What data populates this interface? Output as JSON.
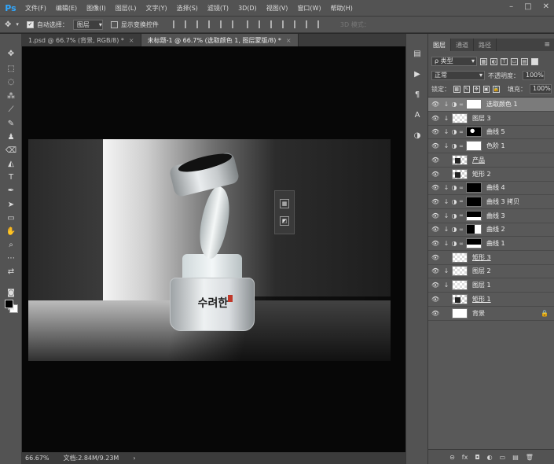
{
  "app": {
    "logo": "Ps"
  },
  "menubar": {
    "items": [
      "文件(F)",
      "编辑(E)",
      "图像(I)",
      "图层(L)",
      "文字(Y)",
      "选择(S)",
      "滤镜(T)",
      "3D(D)",
      "视图(V)",
      "窗口(W)",
      "帮助(H)"
    ],
    "window_controls": [
      "–",
      "□",
      "✕"
    ]
  },
  "optionsbar": {
    "auto_select_label": "自动选择：",
    "auto_select_value": "图层",
    "transform_label": "显示变换控件",
    "mode3d_label": "3D 模式："
  },
  "tabs": [
    {
      "label": "1.psd @ 66.7% (背景, RGB/8) *",
      "close": "×"
    },
    {
      "label": "未标题-1 @ 66.7% (选取颜色 1, 图层蒙版/8) *",
      "close": "×"
    }
  ],
  "statusbar": {
    "zoom": "66.67%",
    "doc_info": "文档:2.84M/9.23M",
    "arrow": "›"
  },
  "canvas": {
    "jar_brand": "수려한"
  },
  "panel": {
    "tabs": [
      "图层",
      "通道",
      "路径"
    ],
    "menu_icon": "≡",
    "filter_label": "ρ 类型",
    "blend_mode": "正常",
    "opacity_label": "不透明度：",
    "opacity_value": "100%",
    "lock_label": "锁定：",
    "fill_label": "填充：",
    "fill_value": "100%",
    "layers": [
      {
        "name": "选取颜色 1",
        "thumb": "white",
        "adj": true,
        "clip": true,
        "selected": true
      },
      {
        "name": "图层 3",
        "thumb": "check",
        "adj": false,
        "clip": true
      },
      {
        "name": "曲线 5",
        "thumb": "spot",
        "adj": true,
        "clip": true
      },
      {
        "name": "色阶 1",
        "thumb": "white",
        "adj": true,
        "clip": true
      },
      {
        "name": "产品",
        "thumb": "shape",
        "adj": false,
        "clip": false,
        "underline": true
      },
      {
        "name": "矩形 2",
        "thumb": "shape",
        "adj": false,
        "clip": false
      },
      {
        "name": "曲线 4",
        "thumb": "black",
        "adj": true,
        "clip": true
      },
      {
        "name": "曲线 3 拷贝",
        "thumb": "black",
        "adj": true,
        "clip": true
      },
      {
        "name": "曲线 3",
        "thumb": "lowwhite",
        "adj": true,
        "clip": true
      },
      {
        "name": "曲线 2",
        "thumb": "mixed",
        "adj": true,
        "clip": true
      },
      {
        "name": "曲线 1",
        "thumb": "lowwhite",
        "adj": true,
        "clip": true
      },
      {
        "name": "矩形 3",
        "thumb": "check",
        "adj": false,
        "clip": false,
        "underline": true
      },
      {
        "name": "图层 2",
        "thumb": "check",
        "adj": false,
        "clip": true
      },
      {
        "name": "图层 1",
        "thumb": "check",
        "adj": false,
        "clip": true
      },
      {
        "name": "矩形 1",
        "thumb": "shape",
        "adj": false,
        "clip": false,
        "underline": true
      },
      {
        "name": "背景",
        "thumb": "white",
        "adj": false,
        "clip": false,
        "locked": true
      }
    ],
    "footer_icons": [
      "⊝",
      "fx",
      "◘",
      "◐",
      "▭",
      "▤",
      "🗑"
    ]
  }
}
